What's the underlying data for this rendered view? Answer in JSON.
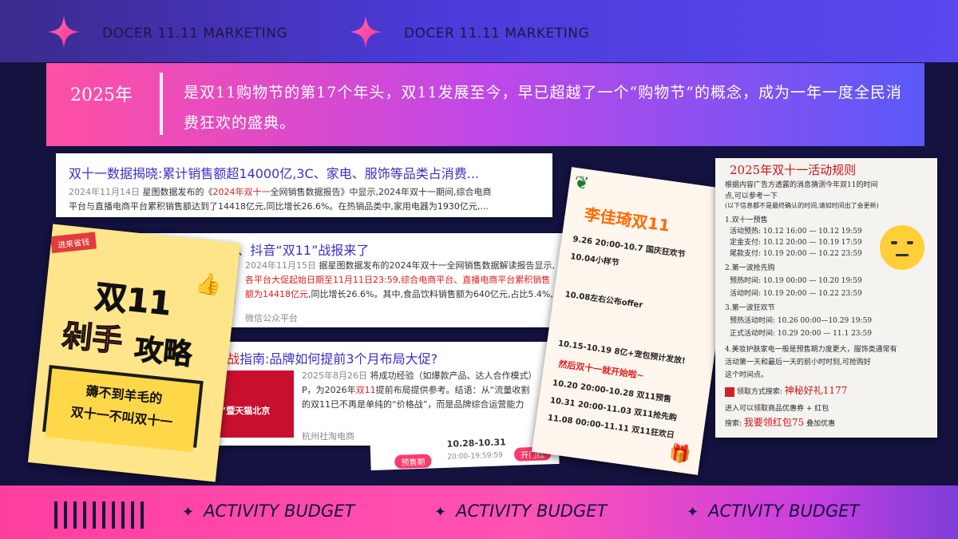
{
  "header": {
    "brand_1": "DOCER 11.11 MARKETING",
    "brand_2": "DOCER 11.11 MARKETING"
  },
  "banner": {
    "year": "2025年",
    "text": "是双11购物节的第17个年头，双11发展至今，早已超越了一个“购物节”的概念，成为一年一度全民消费狂欢的盛典。"
  },
  "news": [
    {
      "title": "双十一数据揭晓:累计销售额超14000亿,3C、家电、服饰等品类占消费...",
      "date": "2024年11月14日",
      "body_1": "星图数据发布的《",
      "body_1_red": "2024年双十一",
      "body_1_tail": "全网销售数据报告》中显示,2024年双十一期间,综合电商",
      "body_2": "平台与直播电商平台累积销售额达到了14418亿元,同比增长26.6%。在热销品类中,家用电器为1930亿元,..."
    },
    {
      "title": "出炉!天猫、京东、抖音“双11”战报来了",
      "date": "2024年11月15日",
      "body_1": "据星图数据发布的2024年双十一全网销售数据解读报告显示,",
      "body_2_red": "各平台大促起始日期至11月11日23:59,综合电商平台、直播电商平台累积销售",
      "body_3_red": "额为14418亿元",
      "body_3": ",同比增长26.6%。其中,食品饮料销售额为640亿元,占比5.4%,...",
      "source": "微信公众平台"
    },
    {
      "title_red": "备战",
      "title": "指南:品牌如何提前3个月布局大促?",
      "date": "2025年8月26日",
      "body_1": "将成功经验（如爆款产品、达人合作模式）",
      "body_2": "P，为2026年",
      "body_2_red": "双11",
      "body_2_tail": "提前布局提供参考。结语：从“流量收割",
      "body_3": "的双11已不再是单纯的“价格战”，而是品牌综合运营能力",
      "source": "杭州社淘电商",
      "thumb_text": "十一”暨天猫北京"
    }
  ],
  "poster": {
    "tag": "进来省钱",
    "line1": "双11",
    "line2a": "剁手",
    "line2b": "攻略",
    "box_1": "薅不到羊毛的",
    "box_2": "双十一不叫双十一"
  },
  "schedule": {
    "title": "李佳琦双11",
    "items": [
      "9.26 20:00-10.7 国庆狂欢节",
      "10.04小样节",
      "10.08左右公布offer",
      "10.15-10.19 8亿+宠包预计发放!",
      "10.20 20:00-10.28 双11预售",
      "10.31 20:00-11.03 双11抢先购",
      "11.08 00:00-11.11 双11狂欢日"
    ],
    "red": "然后双十一就开始啦~"
  },
  "note": {
    "title": "2025年双十一活动规则",
    "lines": [
      "根据内容广告方透露的消息猜测今年双11的时间",
      "点,可以参考一下",
      "(以下信息都不是最终确认的时间,请如时间出了会更新)",
      "1.双十一预售",
      "活动预热: 10.12 16:00 — 10.12 19:59",
      "定金支付: 10.12 20:00 — 10.19 17:59",
      "尾款支付: 10.19 20:00 — 10.22 23:59",
      "2.第一波抢先购",
      "预热时间: 10.19 00:00 — 10.20 19:59",
      "活动时间: 10.19 20:00 — 10.22 23:59",
      "3.第一波狂欢节",
      "预热活动时间: 10.26 00:00—10.29 19:59",
      "正式活动时间: 10.29 20:00 — 11.1 23:59",
      "4.美妆护肤家电一般是预售期力度更大，服饰类通常有",
      "活动第一天和最后一天的前小时时刻,可抢购好",
      "这个时间点。"
    ],
    "gift_label": "领取方式搜索:",
    "gift_red": "神秘好礼1177",
    "coupon_line": "进入可以领取商品优惠券 + 红包",
    "search_label": "搜索:",
    "search_red": "我要领红包75",
    "search_tail": "叠加优惠"
  },
  "progress": {
    "dates": "10.28-10.31",
    "stage_1": "预售期",
    "stage_2": "开门红",
    "time": "20:00-19:59:59"
  },
  "footer": {
    "label_1": "ACTIVITY BUDGET",
    "label_2": "ACTIVITY BUDGET",
    "label_3": "ACTIVITY BUDGET"
  },
  "colors": {
    "navy": "#14123f",
    "pink": "#ff4fa3",
    "violet": "#5a58f8",
    "link_blue": "#3a2fc7",
    "red": "#e01c1c"
  }
}
